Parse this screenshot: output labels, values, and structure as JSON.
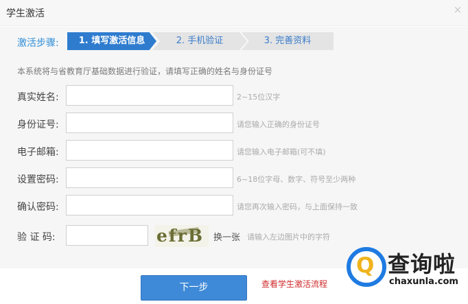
{
  "dialog": {
    "title": "学生激活",
    "close_glyph": "×"
  },
  "steps": {
    "label": "激活步骤:",
    "items": [
      {
        "label": "1. 填写激活信息",
        "active": true
      },
      {
        "label": "2. 手机验证",
        "active": false
      },
      {
        "label": "3. 完善资料",
        "active": false
      }
    ]
  },
  "notice": "本系统将与省教育厅基础数据进行验证，请填写正确的姓名与身份证号",
  "form": {
    "name": {
      "label": "真实姓名:",
      "value": "",
      "hint": "2~15位汉字"
    },
    "id_number": {
      "label": "身份证号:",
      "value": "",
      "hint": "请您输入正确的身份证号"
    },
    "email": {
      "label": "电子邮箱:",
      "value": "",
      "hint": "请您输入电子邮箱(可不填)"
    },
    "password": {
      "label": "设置密码:",
      "value": "",
      "hint": "6~18位字母、数字、符号至少两种"
    },
    "confirm_password": {
      "label": "确认密码:",
      "value": "",
      "hint": "请您再次输入密码，与上面保持一致"
    },
    "captcha": {
      "label": "验 证 码:",
      "value": "",
      "image_text": "efrB",
      "refresh_label": "换一张",
      "hint": "请输入左边图片中的字符"
    }
  },
  "actions": {
    "next_label": "下一步",
    "flow_link_label": "查看学生激活流程"
  },
  "watermark": {
    "title": "查询啦",
    "domain": "chaxunla.com",
    "logo_glyph": "Q"
  },
  "colors": {
    "accent": "#2f7ccf",
    "button": "#3f8ad8",
    "link_red": "#d02a2a",
    "hint_gray": "#aaaaaa"
  },
  "icons": {
    "close": "close-icon",
    "logo": "chaxunla-logo-icon"
  }
}
